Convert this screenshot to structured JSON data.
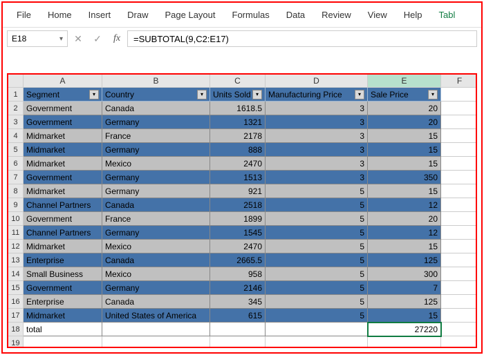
{
  "ribbon": [
    "File",
    "Home",
    "Insert",
    "Draw",
    "Page Layout",
    "Formulas",
    "Data",
    "Review",
    "View",
    "Help",
    "Tabl"
  ],
  "namebox": "E18",
  "fx_cancel": "✕",
  "fx_confirm": "✓",
  "fx_label": "fx",
  "formula": "=SUBTOTAL(9,C2:E17)",
  "cols": [
    "A",
    "B",
    "C",
    "D",
    "E",
    "F"
  ],
  "headers": [
    "Segment",
    "Country",
    "Units Sold",
    "Manufacturing Price",
    "Sale Price"
  ],
  "rows": [
    {
      "seg": "Government",
      "cty": "Canada",
      "units": "1618.5",
      "mfg": "3",
      "sale": "20"
    },
    {
      "seg": "Government",
      "cty": "Germany",
      "units": "1321",
      "mfg": "3",
      "sale": "20"
    },
    {
      "seg": "Midmarket",
      "cty": "France",
      "units": "2178",
      "mfg": "3",
      "sale": "15"
    },
    {
      "seg": "Midmarket",
      "cty": "Germany",
      "units": "888",
      "mfg": "3",
      "sale": "15"
    },
    {
      "seg": "Midmarket",
      "cty": "Mexico",
      "units": "2470",
      "mfg": "3",
      "sale": "15"
    },
    {
      "seg": "Government",
      "cty": "Germany",
      "units": "1513",
      "mfg": "3",
      "sale": "350"
    },
    {
      "seg": "Midmarket",
      "cty": "Germany",
      "units": "921",
      "mfg": "5",
      "sale": "15"
    },
    {
      "seg": "Channel Partners",
      "cty": "Canada",
      "units": "2518",
      "mfg": "5",
      "sale": "12"
    },
    {
      "seg": "Government",
      "cty": "France",
      "units": "1899",
      "mfg": "5",
      "sale": "20"
    },
    {
      "seg": "Channel Partners",
      "cty": "Germany",
      "units": "1545",
      "mfg": "5",
      "sale": "12"
    },
    {
      "seg": "Midmarket",
      "cty": "Mexico",
      "units": "2470",
      "mfg": "5",
      "sale": "15"
    },
    {
      "seg": "Enterprise",
      "cty": "Canada",
      "units": "2665.5",
      "mfg": "5",
      "sale": "125"
    },
    {
      "seg": "Small Business",
      "cty": "Mexico",
      "units": "958",
      "mfg": "5",
      "sale": "300"
    },
    {
      "seg": "Government",
      "cty": "Germany",
      "units": "2146",
      "mfg": "5",
      "sale": "7"
    },
    {
      "seg": "Enterprise",
      "cty": "Canada",
      "units": "345",
      "mfg": "5",
      "sale": "125"
    },
    {
      "seg": "Midmarket",
      "cty": "United States of America",
      "units": "615",
      "mfg": "5",
      "sale": "15"
    }
  ],
  "total_label": "total",
  "total_value": "27220",
  "empty_rows": [
    19
  ]
}
